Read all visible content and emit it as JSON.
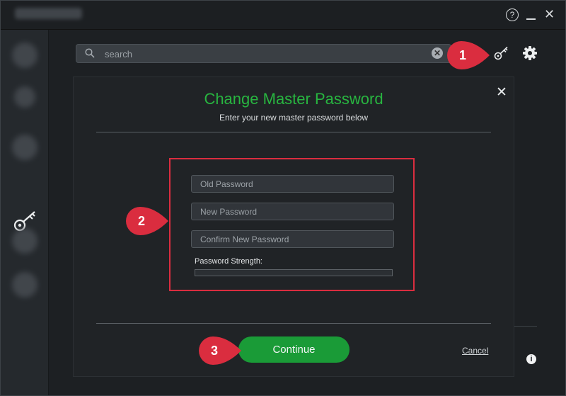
{
  "window": {
    "help_label": "?",
    "close_label": "✕"
  },
  "search": {
    "placeholder": "search",
    "clear_label": "✕"
  },
  "modal": {
    "title": "Change Master Password",
    "subtitle": "Enter your new master password below",
    "close_label": "✕",
    "fields": {
      "old_password": {
        "placeholder": "Old Password",
        "value": ""
      },
      "new_password": {
        "placeholder": "New Password",
        "value": ""
      },
      "confirm_password": {
        "placeholder": "Confirm New Password",
        "value": ""
      }
    },
    "strength_label": "Password Strength:",
    "strength_level": 0,
    "continue_label": "Continue",
    "cancel_label": "Cancel"
  },
  "callouts": [
    "1",
    "2",
    "3"
  ],
  "info_label": "i",
  "icons": {
    "search": "search-icon",
    "key": "key-icon",
    "gear": "gear-icon",
    "info": "info-icon",
    "help": "help-icon",
    "minimize": "minimize-icon",
    "close": "close-icon"
  },
  "colors": {
    "accent_green": "#28b540",
    "button_green": "#1a9b37",
    "annotation_red": "#da2d3f",
    "background": "#1e2124"
  }
}
